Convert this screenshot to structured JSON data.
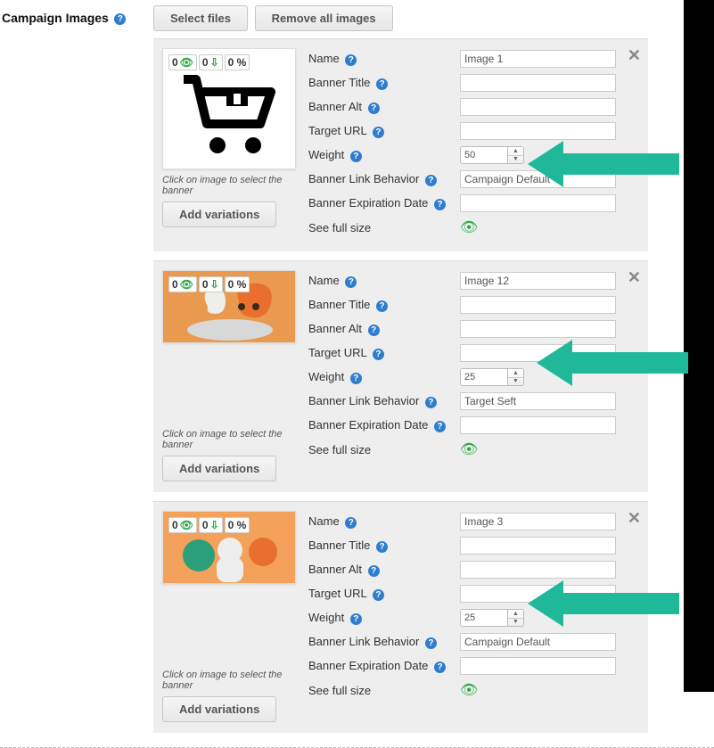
{
  "section": {
    "title": "Campaign Images"
  },
  "buttons": {
    "select_files": "Select files",
    "remove_all": "Remove all images",
    "add_variations": "Add variations"
  },
  "labels": {
    "name": "Name",
    "banner_title": "Banner Title",
    "banner_alt": "Banner Alt",
    "target_url": "Target URL",
    "weight": "Weight",
    "link_behavior": "Banner Link Behavior",
    "expiration": "Banner Expiration Date",
    "full_size": "See full size",
    "thumb_hint": "Click on image to select the banner"
  },
  "stats": {
    "views": "0",
    "clicks": "0",
    "ctr": "0 %"
  },
  "images": [
    {
      "name": "Image 1",
      "banner_title": "",
      "banner_alt": "",
      "target_url": "",
      "weight": "50",
      "link_behavior": "Campaign Default",
      "expiration": ""
    },
    {
      "name": "Image 12",
      "banner_title": "",
      "banner_alt": "",
      "target_url": "",
      "weight": "25",
      "link_behavior": "Target Seft",
      "expiration": ""
    },
    {
      "name": "Image 3",
      "banner_title": "",
      "banner_alt": "",
      "target_url": "",
      "weight": "25",
      "link_behavior": "Campaign Default",
      "expiration": ""
    }
  ]
}
